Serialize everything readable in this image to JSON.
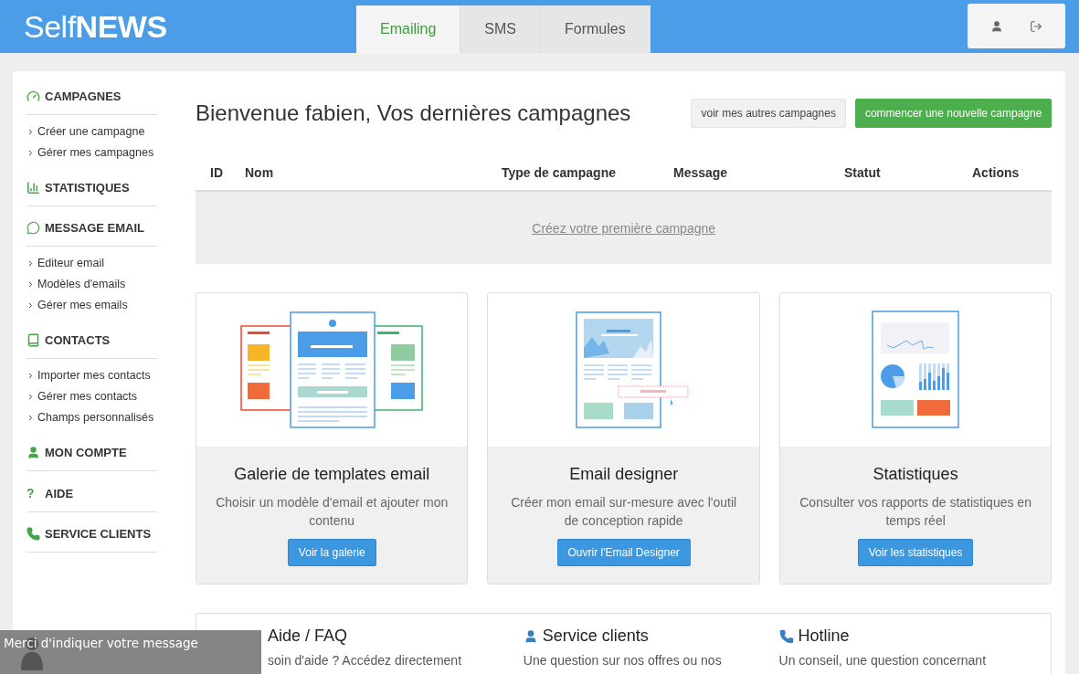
{
  "header": {
    "logo_light": "Self",
    "logo_bold": "NEWS",
    "tabs": [
      {
        "label": "Emailing",
        "selected": true
      },
      {
        "label": "SMS",
        "selected": false
      },
      {
        "label": "Formules",
        "selected": false
      }
    ]
  },
  "sidebar": {
    "sections": [
      {
        "title": "CAMPAGNES",
        "items": [
          "Créer une campagne",
          "Gérer mes campagnes"
        ]
      },
      {
        "title": "STATISTIQUES"
      },
      {
        "title": "MESSAGE EMAIL",
        "items": [
          "Editeur email",
          "Modèles d'emails",
          "Gérer mes emails"
        ]
      },
      {
        "title": "CONTACTS",
        "items": [
          "Importer mes contacts",
          "Gérer mes contacts",
          "Champs personnalisés"
        ]
      },
      {
        "title": "MON COMPTE"
      },
      {
        "glyph": "?",
        "title": "AIDE"
      },
      {
        "title": "SERVICE CLIENTS"
      }
    ]
  },
  "main": {
    "title": "Bienvenue fabien, Vos dernières campagnes",
    "buttons": [
      {
        "label": "voir mes autres campagnes",
        "kind": "default"
      },
      {
        "label": "commencer une nouvelle campagne",
        "kind": "success"
      }
    ],
    "table": {
      "columns": [
        "ID",
        "Nom",
        "Type de campagne",
        "Message",
        "Statut",
        "Actions"
      ],
      "empty_link": "Créez votre première campagne"
    },
    "cards": [
      {
        "title": "Galerie de templates email",
        "text": "Choisir un modèle d'email et ajouter mon contenu",
        "button": "Voir la galerie"
      },
      {
        "title": "Email designer",
        "text": "Créer mon email sur-mesure avec l'outil de conception rapide",
        "button": "Ouvrir l'Email Designer"
      },
      {
        "title": "Statistiques",
        "text": "Consulter vos rapports de statistiques en temps réel",
        "button": "Voir les statistiques"
      }
    ],
    "info": [
      {
        "title": "Aide / FAQ",
        "text": "soin d'aide ? Accédez directement"
      },
      {
        "title": "Service clients",
        "text": "Une question sur nos offres ou nos"
      },
      {
        "title": "Hotline",
        "text": "Un conseil, une question concernant"
      }
    ]
  },
  "chat": {
    "text": "Merci d'indiquer votre message"
  }
}
